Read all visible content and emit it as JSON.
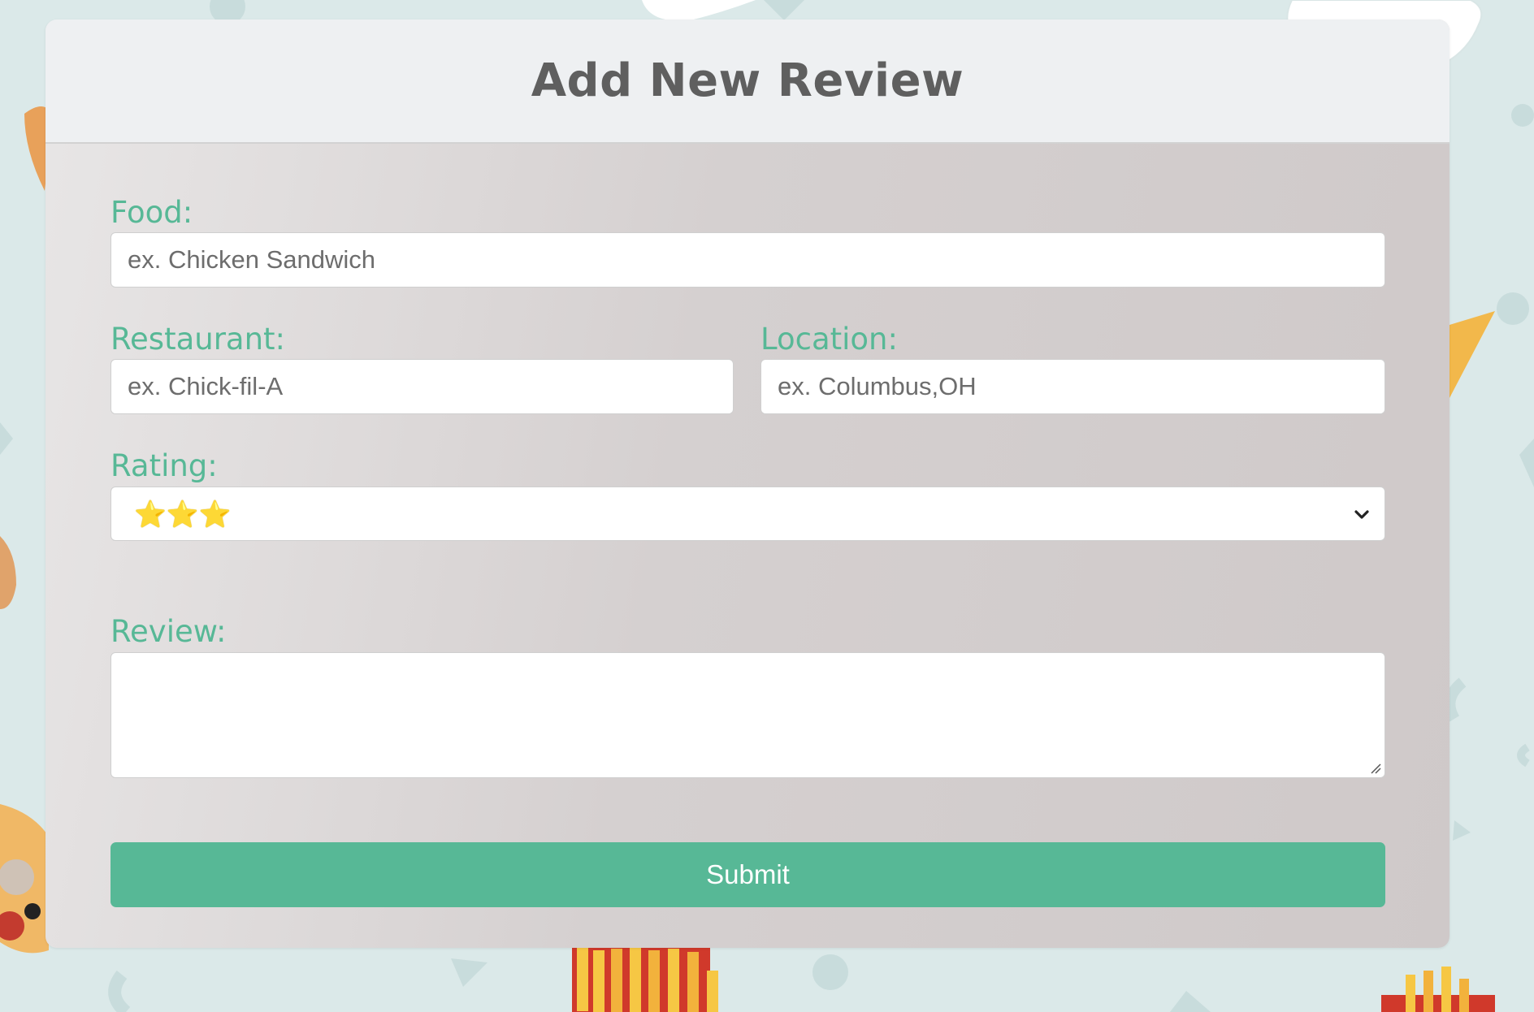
{
  "page": {
    "title": "Add New Review"
  },
  "form": {
    "food": {
      "label": "Food:",
      "placeholder": "ex. Chicken Sandwich",
      "value": ""
    },
    "restaurant": {
      "label": "Restaurant:",
      "placeholder": "ex. Chick-fil-A",
      "value": ""
    },
    "location": {
      "label": "Location:",
      "placeholder": "ex. Columbus,OH",
      "value": ""
    },
    "rating": {
      "label": "Rating:",
      "selected": "⭐⭐⭐",
      "selected_stars": 3
    },
    "review": {
      "label": "Review:",
      "value": ""
    },
    "submit_label": "Submit"
  },
  "colors": {
    "accent": "#57b896",
    "header_bg": "#eef0f2",
    "title_text": "#5f5f5f",
    "background": "#dbe9e9"
  },
  "icons": {
    "select_arrow": "chevron-down-icon",
    "textarea_resize": "resize-grip-icon"
  }
}
